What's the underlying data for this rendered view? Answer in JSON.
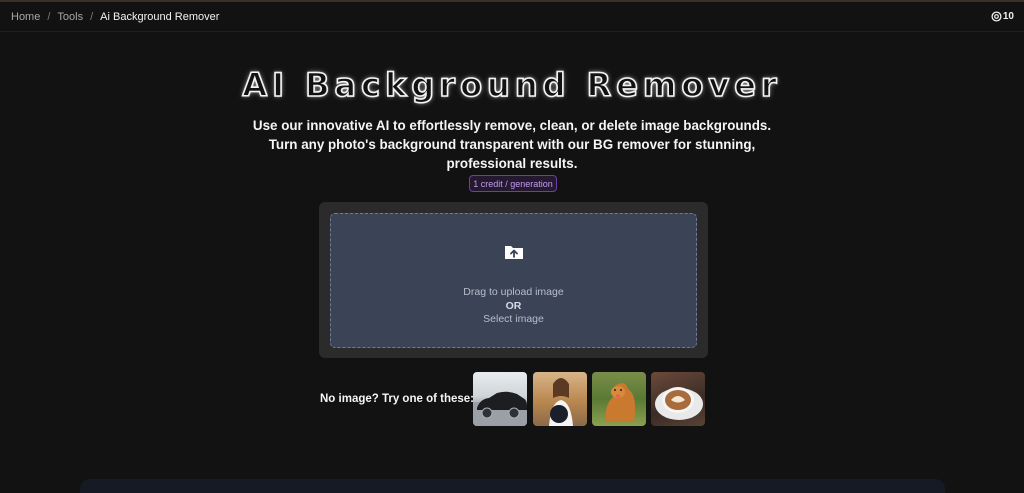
{
  "breadcrumb": {
    "items": [
      "Home",
      "Tools",
      "Ai Background Remover"
    ],
    "separator": "/"
  },
  "credits": {
    "icon": "credit-coin-icon",
    "value": "10"
  },
  "hero": {
    "title": "AI Background Remover",
    "subtitle": "Use our innovative AI to effortlessly remove, clean, or delete image backgrounds. Turn any photo's background transparent with our BG remover for stunning, professional results.",
    "badge": "1 credit / generation"
  },
  "upload": {
    "icon": "folder-upload-icon",
    "drag_text": "Drag to upload image",
    "or_text": "OR",
    "select_text": "Select image"
  },
  "samples": {
    "label": "No image? Try one of these:",
    "items": [
      {
        "subject": "car",
        "icon": "car-sample-thumbnail"
      },
      {
        "subject": "woman with hat",
        "icon": "woman-sample-thumbnail"
      },
      {
        "subject": "dog",
        "icon": "dog-sample-thumbnail"
      },
      {
        "subject": "coffee",
        "icon": "coffee-sample-thumbnail"
      }
    ]
  },
  "colors": {
    "background": "#121212",
    "accent_purple": "#c39bf0",
    "dropzone": "#3b4356"
  }
}
